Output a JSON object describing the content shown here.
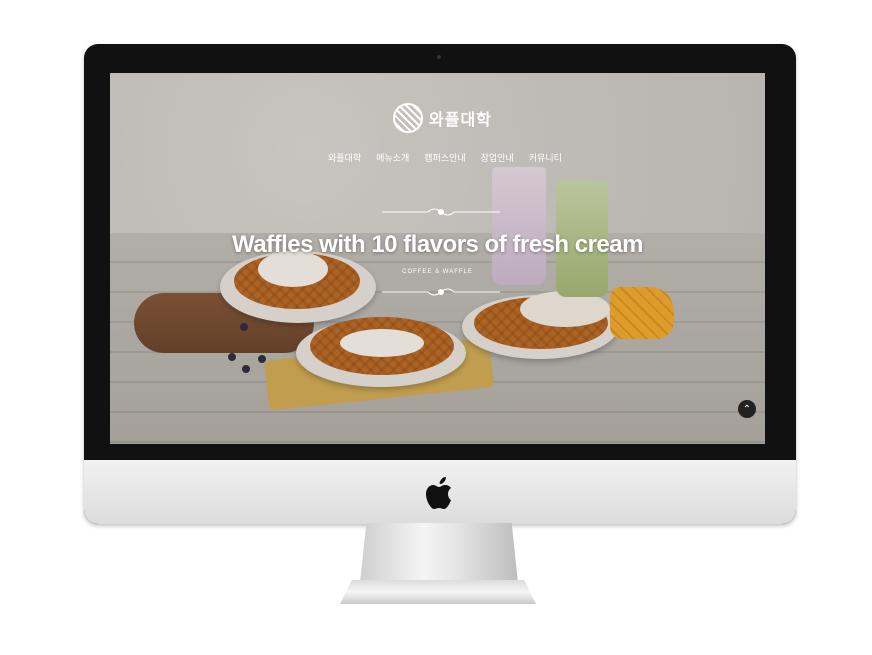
{
  "site": {
    "logo_text": "와플대학",
    "nav": [
      "와플대학",
      "메뉴소개",
      "캠퍼스안내",
      "창업안내",
      "커뮤니티"
    ],
    "hero": {
      "headline": "Waffles with 10 flavors of fresh cream",
      "subline": "COFFEE & WAFFLE"
    },
    "scroll_top_icon": "chevron-up-icon"
  },
  "colors": {
    "bezel": "#111111",
    "text": "#ffffff",
    "accent_waffle": "#d89e4c"
  }
}
